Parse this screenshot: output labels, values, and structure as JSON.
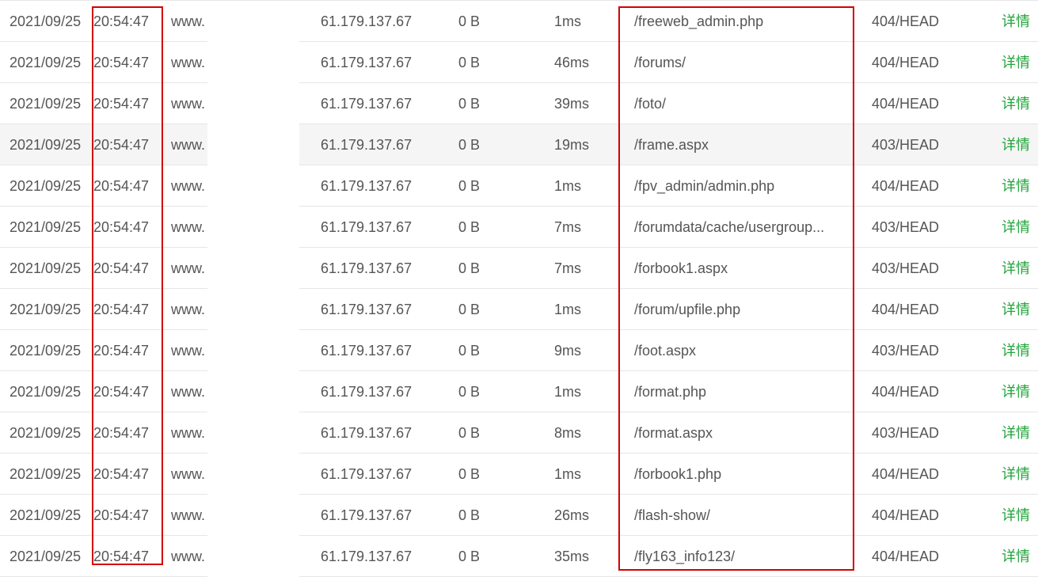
{
  "columns": [
    "date",
    "time",
    "host",
    "ip",
    "size",
    "duration",
    "path",
    "status",
    "action"
  ],
  "colors": {
    "text": "#555555",
    "detail_link": "#20a53a",
    "annotation_frame": "#d40000",
    "row_border": "#e6e6e6",
    "highlight_row": "#f5f5f5"
  },
  "rows": [
    {
      "date": "2021/09/25",
      "time": "20:54:47",
      "host": "www.",
      "ip": "61.179.137.67",
      "size": "0 B",
      "duration": "1ms",
      "path": "/freeweb_admin.php",
      "status": "404/HEAD",
      "action": "详情"
    },
    {
      "date": "2021/09/25",
      "time": "20:54:47",
      "host": "www.",
      "ip": "61.179.137.67",
      "size": "0 B",
      "duration": "46ms",
      "path": "/forums/",
      "status": "404/HEAD",
      "action": "详情"
    },
    {
      "date": "2021/09/25",
      "time": "20:54:47",
      "host": "www.",
      "ip": "61.179.137.67",
      "size": "0 B",
      "duration": "39ms",
      "path": "/foto/",
      "status": "404/HEAD",
      "action": "详情"
    },
    {
      "date": "2021/09/25",
      "time": "20:54:47",
      "host": "www.",
      "ip": "61.179.137.67",
      "size": "0 B",
      "duration": "19ms",
      "path": "/frame.aspx",
      "status": "403/HEAD",
      "action": "详情"
    },
    {
      "date": "2021/09/25",
      "time": "20:54:47",
      "host": "www.",
      "ip": "61.179.137.67",
      "size": "0 B",
      "duration": "1ms",
      "path": "/fpv_admin/admin.php",
      "status": "404/HEAD",
      "action": "详情"
    },
    {
      "date": "2021/09/25",
      "time": "20:54:47",
      "host": "www.",
      "ip": "61.179.137.67",
      "size": "0 B",
      "duration": "7ms",
      "path": "/forumdata/cache/usergroup...",
      "status": "403/HEAD",
      "action": "详情"
    },
    {
      "date": "2021/09/25",
      "time": "20:54:47",
      "host": "www.",
      "ip": "61.179.137.67",
      "size": "0 B",
      "duration": "7ms",
      "path": "/forbook1.aspx",
      "status": "403/HEAD",
      "action": "详情"
    },
    {
      "date": "2021/09/25",
      "time": "20:54:47",
      "host": "www.",
      "ip": "61.179.137.67",
      "size": "0 B",
      "duration": "1ms",
      "path": "/forum/upfile.php",
      "status": "404/HEAD",
      "action": "详情"
    },
    {
      "date": "2021/09/25",
      "time": "20:54:47",
      "host": "www.",
      "ip": "61.179.137.67",
      "size": "0 B",
      "duration": "9ms",
      "path": "/foot.aspx",
      "status": "403/HEAD",
      "action": "详情"
    },
    {
      "date": "2021/09/25",
      "time": "20:54:47",
      "host": "www.",
      "ip": "61.179.137.67",
      "size": "0 B",
      "duration": "1ms",
      "path": "/format.php",
      "status": "404/HEAD",
      "action": "详情"
    },
    {
      "date": "2021/09/25",
      "time": "20:54:47",
      "host": "www.",
      "ip": "61.179.137.67",
      "size": "0 B",
      "duration": "8ms",
      "path": "/format.aspx",
      "status": "403/HEAD",
      "action": "详情"
    },
    {
      "date": "2021/09/25",
      "time": "20:54:47",
      "host": "www.",
      "ip": "61.179.137.67",
      "size": "0 B",
      "duration": "1ms",
      "path": "/forbook1.php",
      "status": "404/HEAD",
      "action": "详情"
    },
    {
      "date": "2021/09/25",
      "time": "20:54:47",
      "host": "www.",
      "ip": "61.179.137.67",
      "size": "0 B",
      "duration": "26ms",
      "path": "/flash-show/",
      "status": "404/HEAD",
      "action": "详情"
    },
    {
      "date": "2021/09/25",
      "time": "20:54:47",
      "host": "www.",
      "ip": "61.179.137.67",
      "size": "0 B",
      "duration": "35ms",
      "path": "/fly163_info123/",
      "status": "404/HEAD",
      "action": "详情"
    }
  ]
}
